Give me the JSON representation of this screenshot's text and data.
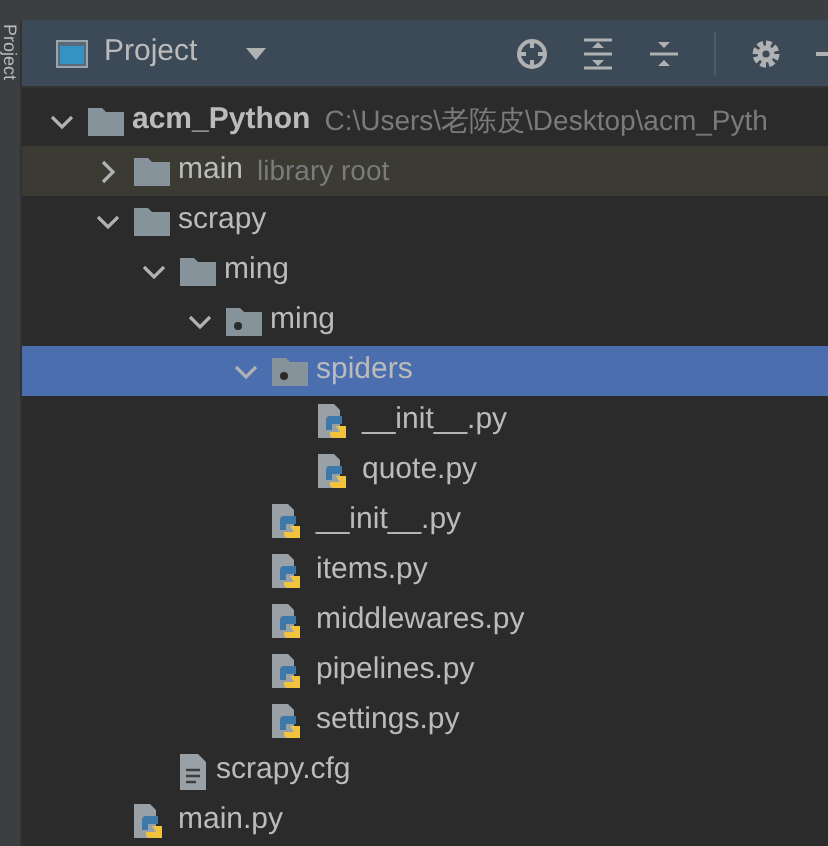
{
  "side_tab": {
    "label": "Project"
  },
  "header": {
    "title": "Project"
  },
  "tree": [
    {
      "name": "acm_Python",
      "kind": "project",
      "hint": "C:\\Users\\老陈皮\\Desktop\\acm_Pyth",
      "expanded": true,
      "selected": false,
      "highlighted": false,
      "children": [
        {
          "name": "main",
          "kind": "folder",
          "hint": "library root",
          "expanded": false,
          "selected": false,
          "highlighted": true
        },
        {
          "name": "scrapy",
          "kind": "folder",
          "expanded": true,
          "selected": false,
          "highlighted": false,
          "children": [
            {
              "name": "ming",
              "kind": "folder",
              "expanded": true,
              "selected": false,
              "highlighted": false,
              "children": [
                {
                  "name": "ming",
                  "kind": "package",
                  "expanded": true,
                  "selected": false,
                  "highlighted": false,
                  "children": [
                    {
                      "name": "spiders",
                      "kind": "package",
                      "expanded": true,
                      "selected": true,
                      "highlighted": false,
                      "children": [
                        {
                          "name": "__init__.py",
                          "kind": "python",
                          "selected": false,
                          "highlighted": false
                        },
                        {
                          "name": "quote.py",
                          "kind": "python",
                          "selected": false,
                          "highlighted": false
                        }
                      ]
                    },
                    {
                      "name": "__init__.py",
                      "kind": "python",
                      "selected": false,
                      "highlighted": false
                    },
                    {
                      "name": "items.py",
                      "kind": "python",
                      "selected": false,
                      "highlighted": false
                    },
                    {
                      "name": "middlewares.py",
                      "kind": "python",
                      "selected": false,
                      "highlighted": false
                    },
                    {
                      "name": "pipelines.py",
                      "kind": "python",
                      "selected": false,
                      "highlighted": false
                    },
                    {
                      "name": "settings.py",
                      "kind": "python",
                      "selected": false,
                      "highlighted": false
                    }
                  ]
                }
              ]
            },
            {
              "name": "scrapy.cfg",
              "kind": "config",
              "selected": false,
              "highlighted": false
            }
          ]
        },
        {
          "name": "main.py",
          "kind": "python",
          "selected": false,
          "highlighted": false
        }
      ]
    }
  ]
}
